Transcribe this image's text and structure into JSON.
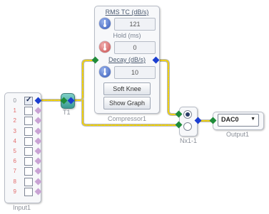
{
  "compressor": {
    "caption": "Compressor1",
    "rms_label": "RMS TC (dB/s)",
    "rms_value": "121",
    "hold_label": "Hold (ms)",
    "hold_value": "0",
    "decay_label": "Decay (dB/s)",
    "decay_value": "10",
    "soft_knee_label": "Soft Knee",
    "show_graph_label": "Show Graph"
  },
  "input": {
    "caption": "Input1",
    "rows": [
      {
        "label": "0",
        "checked": true
      },
      {
        "label": "1",
        "checked": false
      },
      {
        "label": "2",
        "checked": false
      },
      {
        "label": "3",
        "checked": false
      },
      {
        "label": "4",
        "checked": false
      },
      {
        "label": "5",
        "checked": false
      },
      {
        "label": "6",
        "checked": false
      },
      {
        "label": "7",
        "checked": false
      },
      {
        "label": "8",
        "checked": false
      },
      {
        "label": "9",
        "checked": false
      }
    ],
    "check_mark": "✓"
  },
  "t1": {
    "caption": "T1"
  },
  "mux": {
    "caption": "Nx1-1"
  },
  "output": {
    "caption": "Output1",
    "dac_value": "DAC0",
    "dropdown_arrow": "▼"
  },
  "colors": {
    "wire": "#f2d200",
    "pin_input": "#1f8c3a",
    "pin_output": "#1b3ed0",
    "knob_blue": "#2f55b8",
    "knob_red": "#c74949"
  }
}
